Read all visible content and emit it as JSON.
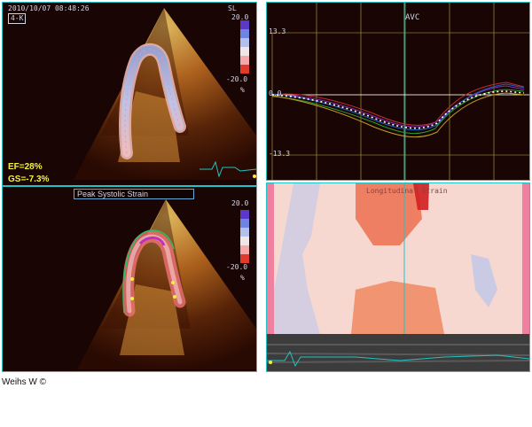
{
  "top_left": {
    "timestamp": "2010/10/07 08:48:26",
    "view_label": "4-K",
    "scale_top": "20.0",
    "scale_bottom": "-20.0",
    "scale_unit": "%",
    "scale_title": "SL",
    "ef": "EF=28%",
    "gs": "GS=-7.3%"
  },
  "bottom_left": {
    "title": "Peak Systolic Strain",
    "scale_top": "20.0",
    "scale_bottom": "-20.0",
    "scale_unit": "%"
  },
  "graph": {
    "event_label": "AVC",
    "y_top": "13.3",
    "y_zero": "0.0",
    "y_bottom": "-13.3"
  },
  "map": {
    "title": "Longitudinal Strain"
  },
  "credit": "Weihs W ©",
  "colors": {
    "panel_bg": "#1a0505",
    "grid": "#c9bf4a",
    "frame": "#22c3c3",
    "accent_yellow": "#f2f23a"
  }
}
